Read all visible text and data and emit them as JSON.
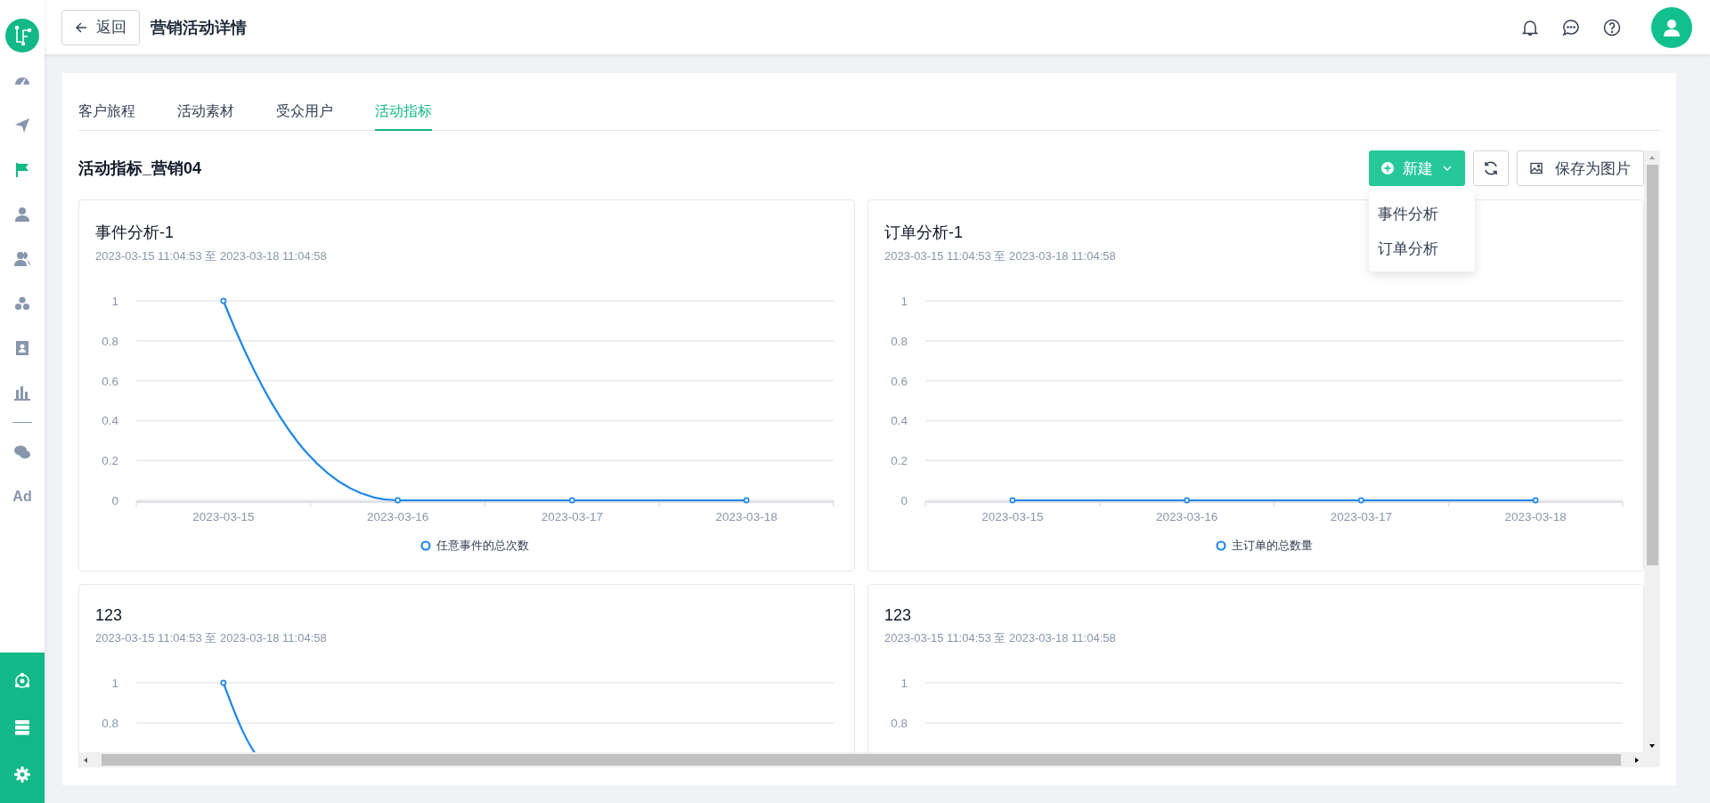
{
  "sidebar": {
    "items": [
      {
        "kind": "gauge",
        "selected": false
      },
      {
        "kind": "send",
        "selected": false
      },
      {
        "kind": "flag",
        "selected": true
      },
      {
        "kind": "user",
        "selected": false
      },
      {
        "kind": "users",
        "selected": false
      },
      {
        "kind": "cluster",
        "selected": false
      },
      {
        "kind": "badge",
        "selected": false
      },
      {
        "kind": "bars",
        "selected": false
      },
      {
        "kind": "divider"
      },
      {
        "kind": "chat",
        "selected": false
      },
      {
        "kind": "text",
        "label": "Ad",
        "selected": false
      }
    ],
    "bottom_items": [
      {
        "kind": "hub"
      },
      {
        "kind": "server"
      },
      {
        "kind": "gear"
      }
    ]
  },
  "header": {
    "back_button": "返回",
    "title": "营销活动详情"
  },
  "tabs": [
    {
      "label": "客户旅程",
      "selected": false
    },
    {
      "label": "活动素材",
      "selected": false
    },
    {
      "label": "受众用户",
      "selected": false
    },
    {
      "label": "活动指标",
      "selected": true
    }
  ],
  "heading": "活动指标_营销04",
  "toolbar": {
    "new_button": "新建",
    "save_button": "保存为图片"
  },
  "new_menu": {
    "items": [
      "事件分析",
      "订单分析"
    ]
  },
  "charts": [
    {
      "title": "事件分析-1",
      "range": "2023-03-15 11:04:53 至 2023-03-18 11:04:58",
      "chart_data": {
        "type": "line",
        "grid": true,
        "categories": [
          "2023-03-15",
          "2023-03-16",
          "2023-03-17",
          "2023-03-18"
        ],
        "yticks": [
          0,
          0.2,
          0.4,
          0.6,
          0.8,
          1
        ],
        "ylim": [
          0,
          1
        ],
        "series": [
          {
            "name": "任意事件的总次数",
            "color": "#1e88e5",
            "marker": true,
            "values": [
              1,
              0,
              0,
              0
            ]
          }
        ]
      }
    },
    {
      "title": "订单分析-1",
      "range": "2023-03-15 11:04:53 至 2023-03-18 11:04:58",
      "chart_data": {
        "type": "line",
        "grid": true,
        "categories": [
          "2023-03-15",
          "2023-03-16",
          "2023-03-17",
          "2023-03-18"
        ],
        "yticks": [
          0,
          0.2,
          0.4,
          0.6,
          0.8,
          1
        ],
        "ylim": [
          0,
          1
        ],
        "series": [
          {
            "name": "主订单的总数量",
            "color": "#1e88e5",
            "marker": true,
            "values": [
              0,
              0,
              0,
              0
            ]
          }
        ]
      }
    },
    {
      "title": "123",
      "range": "2023-03-15 11:04:53 至 2023-03-18 11:04:58",
      "preview": {
        "kind": "falling",
        "y_labels": [
          "1",
          "0.8"
        ]
      }
    },
    {
      "title": "123",
      "range": "2023-03-15 11:04:53 至 2023-03-18 11:04:58",
      "preview": {
        "y_labels": [
          "1",
          "0.8"
        ]
      }
    }
  ]
}
